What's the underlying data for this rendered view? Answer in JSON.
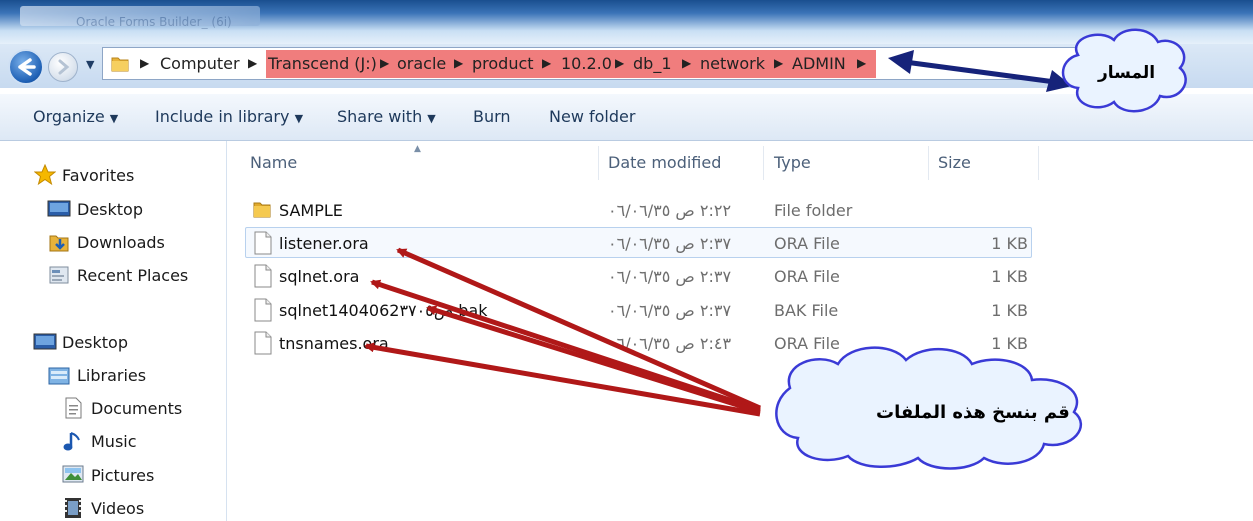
{
  "window": {
    "title": "Oracle Forms Builder_ (6i)"
  },
  "address_bar": {
    "crumbs": [
      "Computer",
      "Transcend (J:)",
      "oracle",
      "product",
      "10.2.0",
      "db_1",
      "network",
      "ADMIN"
    ]
  },
  "toolbar": {
    "organize": "Organize",
    "include": "Include in library",
    "share": "Share with",
    "burn": "Burn",
    "new_folder": "New folder"
  },
  "nav": {
    "favorites": "Favorites",
    "desktop": "Desktop",
    "downloads": "Downloads",
    "recent": "Recent Places",
    "desktop2": "Desktop",
    "libraries": "Libraries",
    "documents": "Documents",
    "music": "Music",
    "pictures": "Pictures",
    "videos": "Videos"
  },
  "columns": {
    "name": "Name",
    "date": "Date modified",
    "type": "Type",
    "size": "Size"
  },
  "files": [
    {
      "name": "SAMPLE",
      "date": "٢:٢٢ ص ٠٦/٠٦/٣٥",
      "type": "File folder",
      "size": ""
    },
    {
      "name": "listener.ora",
      "date": "٢:٣٧ ص ٠٦/٠٦/٣٥",
      "type": "ORA File",
      "size": "1 KB"
    },
    {
      "name": "sqlnet.ora",
      "date": "٢:٣٧ ص ٠٦/٠٦/٣٥",
      "type": "ORA File",
      "size": "1 KB"
    },
    {
      "name": "sqlnet1404062ص٣٧٠٥.bak",
      "date": "٢:٣٧ ص ٠٦/٠٦/٣٥",
      "type": "BAK File",
      "size": "1 KB"
    },
    {
      "name": "tnsnames.ora",
      "date": "٢:٤٣ ص ٠٦/٠٦/٣٥",
      "type": "ORA File",
      "size": "1 KB"
    }
  ],
  "annotations": {
    "path_label": "المسار",
    "copy_label": "قم بنسخ هذه الملفات"
  },
  "colors": {
    "highlight": "#f07d7d",
    "arrow_red": "#b01818",
    "arrow_blue": "#16237a"
  }
}
